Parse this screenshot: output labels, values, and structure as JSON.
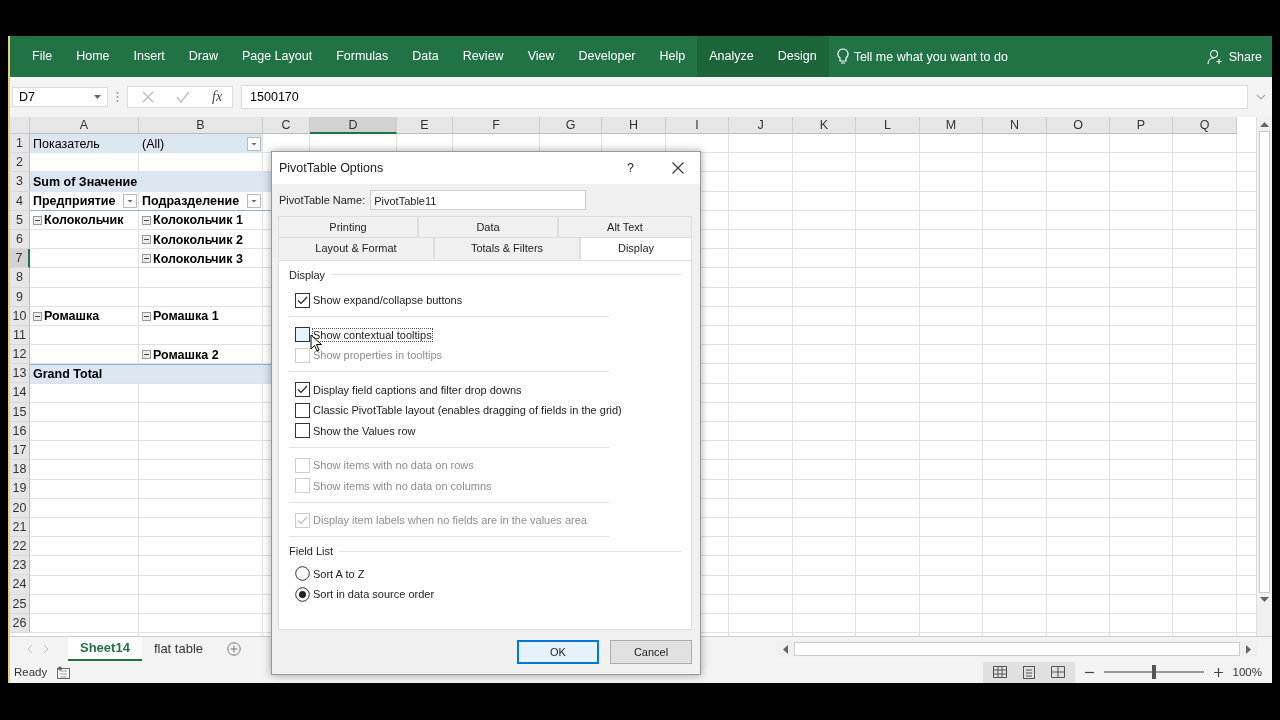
{
  "ribbon": {
    "tabs": [
      {
        "label": "File",
        "contextual": false
      },
      {
        "label": "Home",
        "contextual": false
      },
      {
        "label": "Insert",
        "contextual": false
      },
      {
        "label": "Draw",
        "contextual": false
      },
      {
        "label": "Page Layout",
        "contextual": false
      },
      {
        "label": "Formulas",
        "contextual": false
      },
      {
        "label": "Data",
        "contextual": false
      },
      {
        "label": "Review",
        "contextual": false
      },
      {
        "label": "View",
        "contextual": false
      },
      {
        "label": "Developer",
        "contextual": false
      },
      {
        "label": "Help",
        "contextual": false
      },
      {
        "label": "Analyze",
        "contextual": true
      },
      {
        "label": "Design",
        "contextual": true
      }
    ],
    "tell_me": "Tell me what you want to do",
    "share": "Share"
  },
  "formula_bar": {
    "name_box": "D7",
    "fx": "fx",
    "value": "1500170"
  },
  "columns": [
    {
      "label": "A",
      "selected": false
    },
    {
      "label": "B",
      "selected": false
    },
    {
      "label": "C",
      "selected": false
    },
    {
      "label": "D",
      "selected": true
    },
    {
      "label": "E",
      "selected": false
    },
    {
      "label": "F",
      "selected": false
    },
    {
      "label": "G",
      "selected": false
    },
    {
      "label": "H",
      "selected": false
    },
    {
      "label": "I",
      "selected": false
    },
    {
      "label": "J",
      "selected": false
    },
    {
      "label": "K",
      "selected": false
    },
    {
      "label": "L",
      "selected": false
    },
    {
      "label": "M",
      "selected": false
    },
    {
      "label": "N",
      "selected": false
    },
    {
      "label": "O",
      "selected": false
    },
    {
      "label": "P",
      "selected": false
    },
    {
      "label": "Q",
      "selected": false
    }
  ],
  "rows": [
    {
      "number": "1",
      "selected": false,
      "kind": "filter",
      "column_a": {
        "text": "Показатель"
      },
      "column_b": {
        "text": "(All)",
        "dropdown": true
      }
    },
    {
      "number": "2",
      "selected": false,
      "kind": "plain"
    },
    {
      "number": "3",
      "selected": false,
      "kind": "header",
      "column_a": {
        "text": "Sum of Значение"
      }
    },
    {
      "number": "4",
      "selected": false,
      "kind": "field",
      "column_a": {
        "text": "Предприятие",
        "dropdown": true
      },
      "column_b": {
        "text": "Подразделение",
        "dropdown": true
      }
    },
    {
      "number": "5",
      "selected": false,
      "kind": "item",
      "column_a": {
        "text": "Колокольчик",
        "expanded": true
      },
      "column_b": {
        "text": "Колокольчик 1",
        "expanded": true
      }
    },
    {
      "number": "6",
      "selected": false,
      "kind": "item",
      "column_b": {
        "text": "Колокольчик 2",
        "expanded": true
      }
    },
    {
      "number": "7",
      "selected": true,
      "kind": "item",
      "column_b": {
        "text": "Колокольчик 3",
        "expanded": true
      }
    },
    {
      "number": "8",
      "selected": false,
      "kind": "item"
    },
    {
      "number": "9",
      "selected": false,
      "kind": "item"
    },
    {
      "number": "10",
      "selected": false,
      "kind": "item",
      "column_a": {
        "text": "Ромашка",
        "expanded": true
      },
      "column_b": {
        "text": "Ромашка 1",
        "expanded": true
      }
    },
    {
      "number": "11",
      "selected": false,
      "kind": "item"
    },
    {
      "number": "12",
      "selected": false,
      "kind": "item",
      "column_b": {
        "text": "Ромашка 2",
        "expanded": true
      }
    },
    {
      "number": "13",
      "selected": false,
      "kind": "total",
      "column_a": {
        "text": "Grand Total"
      }
    },
    {
      "number": "14",
      "selected": false,
      "kind": "plain"
    },
    {
      "number": "15",
      "selected": false,
      "kind": "plain"
    },
    {
      "number": "16",
      "selected": false,
      "kind": "plain"
    },
    {
      "number": "17",
      "selected": false,
      "kind": "plain"
    },
    {
      "number": "18",
      "selected": false,
      "kind": "plain"
    },
    {
      "number": "19",
      "selected": false,
      "kind": "plain"
    },
    {
      "number": "20",
      "selected": false,
      "kind": "plain"
    },
    {
      "number": "21",
      "selected": false,
      "kind": "plain"
    },
    {
      "number": "22",
      "selected": false,
      "kind": "plain"
    },
    {
      "number": "23",
      "selected": false,
      "kind": "plain"
    },
    {
      "number": "24",
      "selected": false,
      "kind": "plain"
    },
    {
      "number": "25",
      "selected": false,
      "kind": "plain"
    },
    {
      "number": "26",
      "selected": false,
      "kind": "plain"
    }
  ],
  "sheet_tabs": [
    {
      "label": "Sheet14",
      "selected": true
    },
    {
      "label": "flat table",
      "selected": false
    }
  ],
  "status_bar": {
    "text": "Ready",
    "zoom": {
      "level": 0.5
    },
    "zoom_label": "100%"
  },
  "dialog": {
    "title": "PivotTable Options",
    "help": "?",
    "name_label": "PivotTable Name:",
    "name_value": "PivotTable11",
    "tab_rows": [
      [
        {
          "label": "Printing",
          "selected": false
        },
        {
          "label": "Data",
          "selected": false
        },
        {
          "label": "Alt Text",
          "selected": false
        }
      ],
      [
        {
          "label": "Layout & Format",
          "selected": false
        },
        {
          "label": "Totals & Filters",
          "selected": false
        },
        {
          "label": "Display",
          "selected": true
        }
      ]
    ],
    "display_section": "Display",
    "option_groups": [
      [
        {
          "label": "Show expand/collapse buttons",
          "checked": true,
          "disabled": false,
          "focused": false
        }
      ],
      [
        {
          "label": "Show contextual tooltips",
          "checked": false,
          "disabled": false,
          "focused": true
        },
        {
          "label": "Show properties in tooltips",
          "checked": false,
          "disabled": true,
          "focused": false
        }
      ],
      [
        {
          "label": "Display field captions and filter drop downs",
          "checked": true,
          "disabled": false,
          "focused": false
        },
        {
          "label": "Classic PivotTable layout (enables dragging of fields in the grid)",
          "checked": false,
          "disabled": false,
          "focused": false
        },
        {
          "label": "Show the Values row",
          "checked": false,
          "disabled": false,
          "focused": false
        }
      ],
      [
        {
          "label": "Show items with no data on rows",
          "checked": false,
          "disabled": true,
          "focused": false
        },
        {
          "label": "Show items with no data on columns",
          "checked": false,
          "disabled": true,
          "focused": false
        }
      ],
      [
        {
          "label": "Display item labels when no fields are in the values area",
          "checked": true,
          "disabled": true,
          "focused": false
        }
      ]
    ],
    "field_list_section": "Field List",
    "radios": [
      {
        "label": "Sort A to Z",
        "selected": false
      },
      {
        "label": "Sort in data source order",
        "selected": true
      }
    ],
    "buttons": [
      {
        "label": "OK",
        "kind": "default"
      },
      {
        "label": "Cancel",
        "kind": "normal"
      }
    ]
  }
}
